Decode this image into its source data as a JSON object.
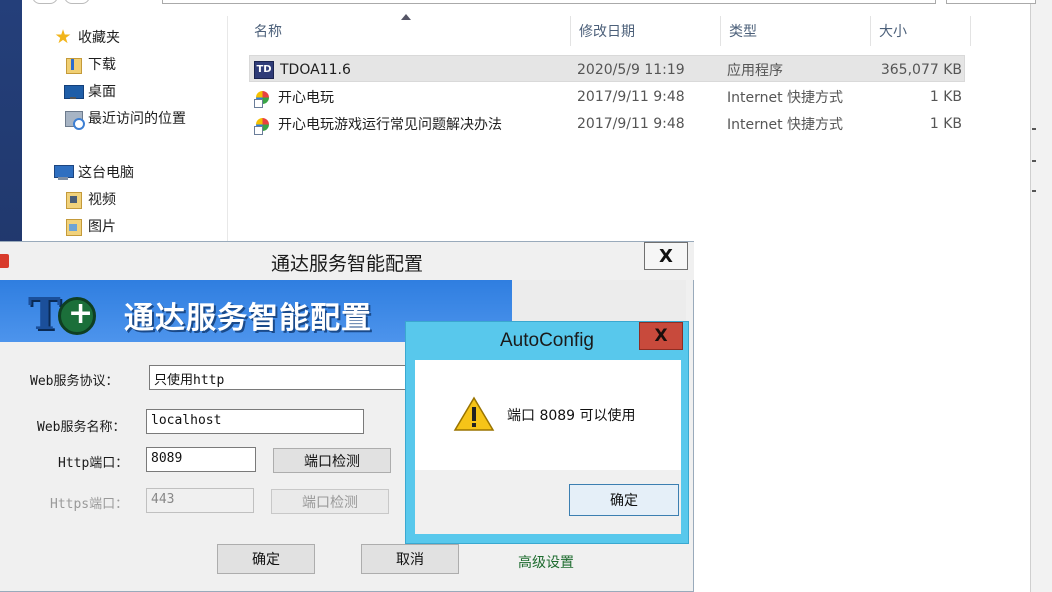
{
  "explorer": {
    "sidebar": {
      "favorites_label": "收藏夹",
      "items": [
        {
          "label": "下载",
          "icon": "download-folder-icon"
        },
        {
          "label": "桌面",
          "icon": "desktop-icon"
        },
        {
          "label": "最近访问的位置",
          "icon": "recent-places-icon"
        }
      ],
      "this_pc_label": "这台电脑",
      "pc_items": [
        {
          "label": "视频",
          "icon": "videos-folder-icon"
        },
        {
          "label": "图片",
          "icon": "pictures-folder-icon"
        }
      ]
    },
    "columns": {
      "name": "名称",
      "modified": "修改日期",
      "type": "类型",
      "size": "大小"
    },
    "files": [
      {
        "name": "TDOA11.6",
        "modified": "2020/5/9 11:19",
        "type": "应用程序",
        "size": "365,077 KB",
        "icon": "td-app-icon",
        "selected": true
      },
      {
        "name": "开心电玩",
        "modified": "2017/9/11 9:48",
        "type": "Internet 快捷方式",
        "size": "1 KB",
        "icon": "internet-shortcut-icon",
        "selected": false
      },
      {
        "name": "开心电玩游戏运行常见问题解决办法",
        "modified": "2017/9/11 9:48",
        "type": "Internet 快捷方式",
        "size": "1 KB",
        "icon": "internet-shortcut-icon",
        "selected": false
      }
    ]
  },
  "config_dialog": {
    "title": "通达服务智能配置",
    "close_label": "X",
    "banner_text": "通达服务智能配置",
    "protocol_label": "Web服务协议：",
    "protocol_value": "只使用http",
    "name_label": "Web服务名称：",
    "name_value": "localhost",
    "http_port_label": "Http端口：",
    "http_port_value": "8089",
    "check_port_label": "端口检测",
    "https_port_label": "Https端口：",
    "https_port_value": "443",
    "check_port2_label": "端口检测",
    "ok_label": "确定",
    "cancel_label": "取消",
    "advanced_label": "高级设置"
  },
  "message_box": {
    "title": "AutoConfig",
    "close_label": "X",
    "message": "端口 8089 可以使用",
    "ok_label": "确定"
  },
  "colors": {
    "message_box_frame": "#58c8ec",
    "close_button_red": "#c84a3c",
    "banner_blue": "#2f7ee0",
    "advanced_link_green": "#1d6b2e"
  }
}
